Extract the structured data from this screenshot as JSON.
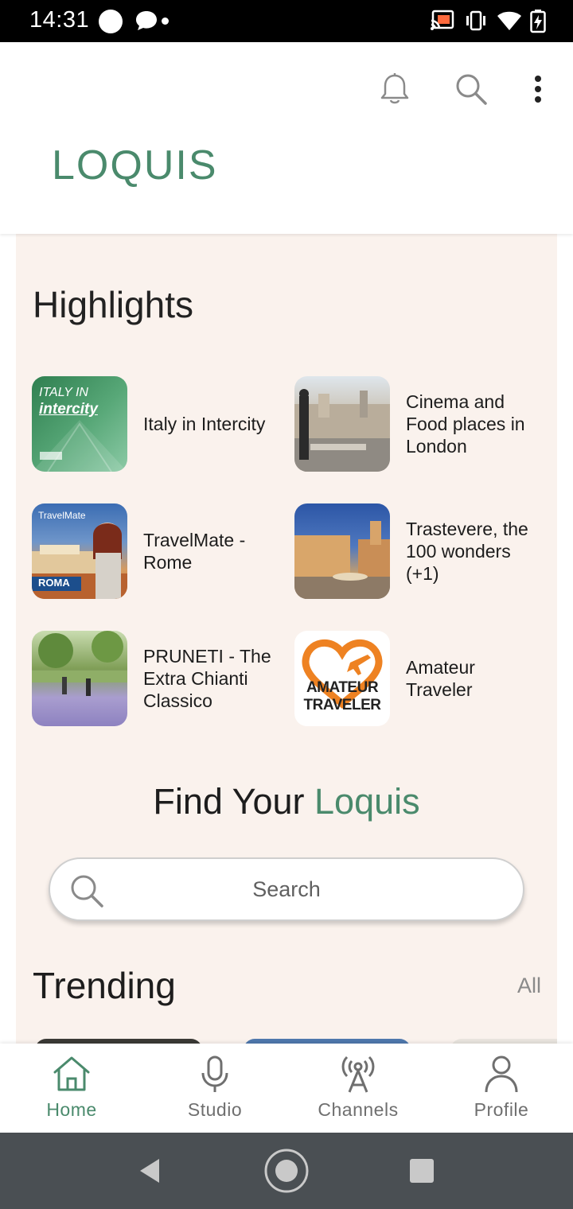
{
  "status_bar": {
    "time": "14:31",
    "icons": [
      "notification-dot-icon",
      "chat-bubble-icon",
      "cast-icon",
      "vibrate-icon",
      "wifi-icon",
      "battery-charging-icon"
    ]
  },
  "header": {
    "logo": "LOQUIS",
    "actions": [
      "bell-icon",
      "search-icon",
      "more-vert-icon"
    ]
  },
  "highlights": {
    "title": "Highlights",
    "items": [
      {
        "label": "Italy in Intercity",
        "thumb_caption": "ITALY IN",
        "thumb_caption2": "intercity",
        "colors": [
          "#3b8f5e",
          "#6bb58a"
        ]
      },
      {
        "label": "Cinema and Food places in London",
        "colors": [
          "#9aa3ab",
          "#d7c9b6"
        ]
      },
      {
        "label": "TravelMate - Rome",
        "thumb_caption": "TravelMate",
        "thumb_caption2": "ROMA",
        "colors": [
          "#3a62a8",
          "#e07a3a"
        ]
      },
      {
        "label": "Trastevere, the 100 wonders (+1)",
        "colors": [
          "#3a5fa8",
          "#d9b070"
        ]
      },
      {
        "label": "PRUNETI - The Extra Chianti Classico",
        "colors": [
          "#6e8f4a",
          "#a79ccf"
        ]
      },
      {
        "label": "Amateur Traveler",
        "thumb_caption": "AMATEUR",
        "thumb_caption2": "TRAVELER",
        "colors": [
          "#ffffff",
          "#f08a2a"
        ]
      }
    ]
  },
  "find": {
    "prefix": "Find Your ",
    "accent": "Loquis"
  },
  "search": {
    "placeholder": "Search"
  },
  "trending": {
    "title": "Trending",
    "all_label": "All"
  },
  "bottom_nav": {
    "items": [
      {
        "label": "Home",
        "icon": "home-icon",
        "active": true
      },
      {
        "label": "Studio",
        "icon": "microphone-icon",
        "active": false
      },
      {
        "label": "Channels",
        "icon": "antenna-icon",
        "active": false
      },
      {
        "label": "Profile",
        "icon": "person-icon",
        "active": false
      }
    ]
  },
  "system_nav": [
    "back-icon",
    "home-circle-icon",
    "recents-icon"
  ],
  "colors": {
    "accent": "#4a8a6c",
    "panel_bg": "#faf2ed",
    "text": "#1d1d1d",
    "muted": "#8a8a8a"
  }
}
